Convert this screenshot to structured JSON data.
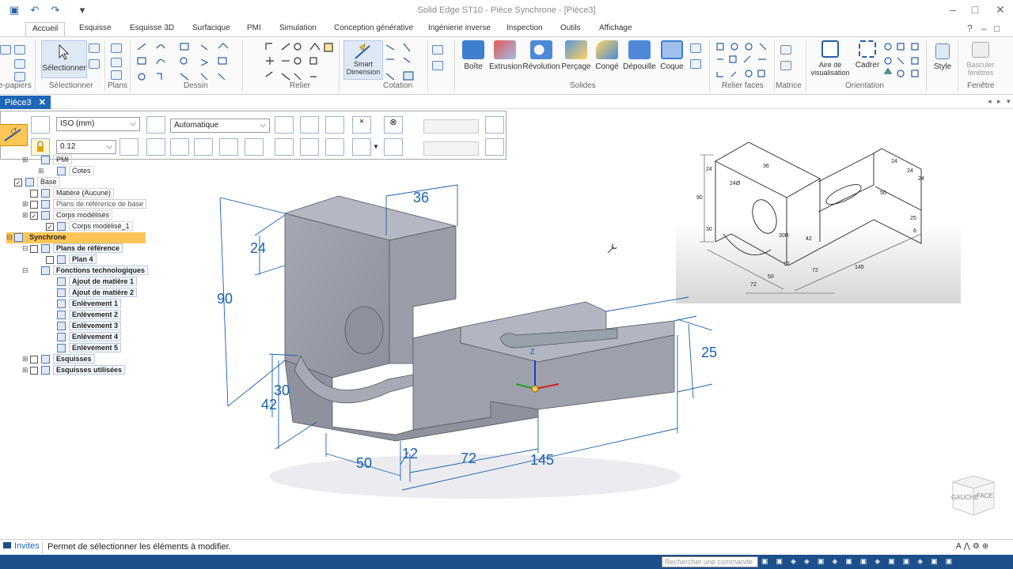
{
  "window": {
    "title": "Solid Edge ST10 - Pièce Synchrone - [Pièce3]"
  },
  "tabs": [
    "Accueil",
    "Esquisse",
    "Esquisse 3D",
    "Surfacique",
    "PMI",
    "Simulation",
    "Conception générative",
    "Ingénierie inverse",
    "Inspection",
    "Outils",
    "Affichage"
  ],
  "ribbon": {
    "groups": [
      "e-papiers",
      "Sélectionner",
      "Plans",
      "Dessin",
      "Relier",
      "Cotation",
      "Solides",
      "Relier faces",
      "Matrice",
      "Orientation",
      "Fenêtre"
    ],
    "select_label": "Sélectionner",
    "smart_dimension": "Smart Dimension",
    "solids": [
      "Boîte",
      "Extrusion",
      "Révolution",
      "Perçage",
      "Congé",
      "Dépouille",
      "Coque"
    ],
    "orientation": [
      "Aire de visualisation",
      "Cadrer"
    ],
    "style_label": "Style",
    "window_label": "Basculer fenêtres"
  },
  "doc_tab": "Pièce3",
  "cmdbar": {
    "standard": "ISO (mm)",
    "mode": "Automatique",
    "precision": "0.12"
  },
  "tree": [
    {
      "label": "PMI",
      "indent": 1,
      "icon": true
    },
    {
      "label": "Cotes",
      "indent": 2,
      "icon": true
    },
    {
      "label": "Base",
      "indent": 0,
      "check": true,
      "icon": true
    },
    {
      "label": "Matière (Aucune)",
      "indent": 1,
      "icon": true
    },
    {
      "label": "Plans de référence de base",
      "indent": 1,
      "icon": true,
      "grey": true
    },
    {
      "label": "Corps modélisés",
      "indent": 1,
      "icon": true
    },
    {
      "label": "Corps modélisé_1",
      "indent": 2,
      "icon": true
    },
    {
      "label": "Synchrone",
      "indent": 0,
      "icon": true,
      "highlight": true
    },
    {
      "label": "Plans de référence",
      "indent": 1,
      "icon": true,
      "bold": true
    },
    {
      "label": "Plan 4",
      "indent": 2,
      "icon": true,
      "bold": true
    },
    {
      "label": "Fonctions technologiques",
      "indent": 1,
      "icon": true,
      "bold": true
    },
    {
      "label": "Ajout de matière 1",
      "indent": 2,
      "icon": true,
      "bold": true
    },
    {
      "label": "Ajout de matière 2",
      "indent": 2,
      "icon": true,
      "bold": true
    },
    {
      "label": "Enlèvement 1",
      "indent": 2,
      "icon": true,
      "bold": true
    },
    {
      "label": "Enlèvement 2",
      "indent": 2,
      "icon": true,
      "bold": true
    },
    {
      "label": "Enlèvement 3",
      "indent": 2,
      "icon": true,
      "bold": true
    },
    {
      "label": "Enlèvement 4",
      "indent": 2,
      "icon": true,
      "bold": true
    },
    {
      "label": "Enlèvement 5",
      "indent": 2,
      "icon": true,
      "bold": true
    },
    {
      "label": "Esquisses",
      "indent": 1,
      "icon": true,
      "bold": true
    },
    {
      "label": "Esquisses utilisées",
      "indent": 1,
      "icon": true,
      "bold": true
    }
  ],
  "dimensions": {
    "top_width": "36",
    "upper_height": "24",
    "total_height": "90",
    "lower_height": "30",
    "hole_height": "42",
    "depth": "50",
    "slot_width": "12",
    "base_mid": "72",
    "total_length": "145",
    "right_height": "25"
  },
  "ref_dims": [
    "36",
    "24",
    "90",
    "24",
    "30",
    "24Ø",
    "50",
    "42",
    "30R",
    "12",
    "72",
    "145",
    "50",
    "72",
    "25",
    "6",
    "24",
    "24"
  ],
  "viewcube": {
    "left": "GAUCHE",
    "front": "FACE"
  },
  "status": {
    "prompt": "Invites",
    "message": "Permet de sélectionner les éléments à modifier.",
    "search_placeholder": "Rechercher une commande"
  },
  "colors": {
    "accent": "#1e66b8",
    "dim": "#1a5fb4",
    "part": "#a3a7b2",
    "highlight": "#ffc657"
  }
}
